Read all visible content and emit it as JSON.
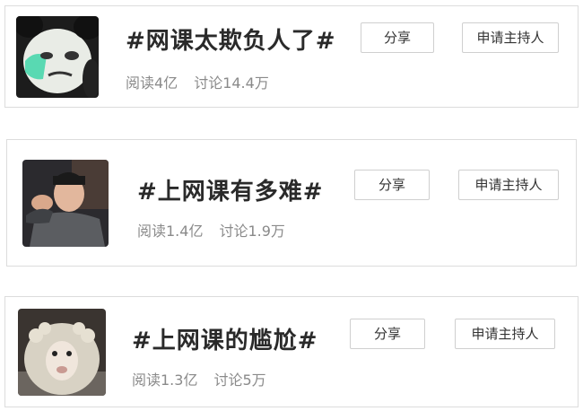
{
  "topics": [
    {
      "title": "#网课太欺负人了#",
      "reads": "阅读4亿",
      "discussions": "讨论14.4万",
      "share_label": "分享",
      "host_label": "申请主持人"
    },
    {
      "title": "#上网课有多难#",
      "reads": "阅读1.4亿",
      "discussions": "讨论1.9万",
      "share_label": "分享",
      "host_label": "申请主持人"
    },
    {
      "title": "#上网课的尴尬#",
      "reads": "阅读1.3亿",
      "discussions": "讨论5万",
      "share_label": "分享",
      "host_label": "申请主持人"
    }
  ]
}
